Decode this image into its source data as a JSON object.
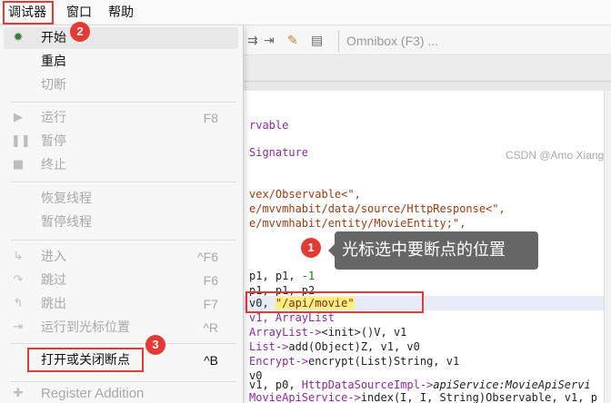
{
  "menubar": {
    "debug": "调试器",
    "window": "窗口",
    "help": "帮助"
  },
  "toolbar": {
    "omnibox_placeholder": "Omnibox (F3) ..."
  },
  "dropdown": {
    "start": {
      "label": "开始",
      "icon": "bug-icon"
    },
    "restart": {
      "label": "重启"
    },
    "detach": {
      "label": "切断"
    },
    "run": {
      "label": "运行",
      "shortcut": "F8"
    },
    "pause": {
      "label": "暂停"
    },
    "stop": {
      "label": "终止"
    },
    "resume_thread": {
      "label": "恢复线程"
    },
    "suspend_thread": {
      "label": "暂停线程"
    },
    "step_into": {
      "label": "进入",
      "shortcut": "^F6"
    },
    "step_over": {
      "label": "跳过",
      "shortcut": "F6"
    },
    "step_out": {
      "label": "跳出",
      "shortcut": "F7"
    },
    "run_to_cursor": {
      "label": "运行到光标位置",
      "shortcut": "^R"
    },
    "toggle_breakpoint": {
      "label": "打开或关闭断点",
      "shortcut": "^B"
    },
    "register_addition": {
      "label": "Register Addition"
    }
  },
  "code": {
    "l1": "rvable",
    "l2": "Signature",
    "l3": "vex/Observable<\",",
    "l4": "e/mvvmhabit/data/source/HttpResponse<\",",
    "l5": "e/mvvmhabit/entity/MovieEntity;\",",
    "l6a": "p1, p1, ",
    "l6b": "-1",
    "l7": "p1, p1, p2",
    "l8a": "v0, ",
    "l8b": "\"/api/movie\"",
    "l9": "v1, ArrayList",
    "l10a": "ArrayList->",
    "l10b": "<init>()V, v1",
    "l11a": "List->",
    "l11b": "add(Object)Z, v1, v0",
    "l12a": "Encrypt->",
    "l12b": "encrypt(List)String, v1",
    "l13": "v0",
    "l14a": "v1, p0, ",
    "l14b": "HttpDataSourceImpl->",
    "l14c": "apiService:MovieApiServi",
    "l15a": "MovieApiService->",
    "l15b": "index(I, I, String)Observable, v1, p"
  },
  "tooltip": "光标选中要断点的位置",
  "watermark": "CSDN @Amo Xiang",
  "badges": {
    "one": "1",
    "two": "2",
    "three": "3"
  },
  "colors": {
    "annotation_red": "#e53935",
    "tooltip_bg": "#666666",
    "string_highlight": "#fff27a"
  }
}
